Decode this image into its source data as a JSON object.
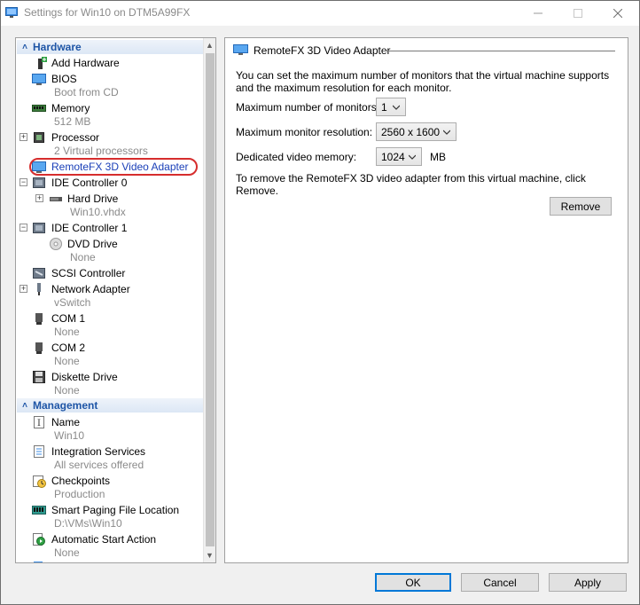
{
  "window": {
    "title": "Settings for Win10 on DTM5A99FX"
  },
  "tree": {
    "hardware_header": "Hardware",
    "management_header": "Management",
    "items": [
      {
        "label": "Add Hardware",
        "sub": ""
      },
      {
        "label": "BIOS",
        "sub": "Boot from CD"
      },
      {
        "label": "Memory",
        "sub": "512 MB"
      },
      {
        "label": "Processor",
        "sub": "2 Virtual processors"
      },
      {
        "label": "RemoteFX 3D Video Adapter",
        "sub": ""
      },
      {
        "label": "IDE Controller 0",
        "sub": ""
      },
      {
        "label": "Hard Drive",
        "sub": "Win10.vhdx"
      },
      {
        "label": "IDE Controller 1",
        "sub": ""
      },
      {
        "label": "DVD Drive",
        "sub": "None"
      },
      {
        "label": "SCSI Controller",
        "sub": ""
      },
      {
        "label": "Network Adapter",
        "sub": "vSwitch"
      },
      {
        "label": "COM 1",
        "sub": "None"
      },
      {
        "label": "COM 2",
        "sub": "None"
      },
      {
        "label": "Diskette Drive",
        "sub": "None"
      }
    ],
    "mgmt_items": [
      {
        "label": "Name",
        "sub": "Win10"
      },
      {
        "label": "Integration Services",
        "sub": "All services offered"
      },
      {
        "label": "Checkpoints",
        "sub": "Production"
      },
      {
        "label": "Smart Paging File Location",
        "sub": "D:\\VMs\\Win10"
      },
      {
        "label": "Automatic Start Action",
        "sub": "None"
      }
    ]
  },
  "panel": {
    "title": "RemoteFX 3D Video Adapter",
    "description": "You can set the maximum number of monitors that the virtual machine supports and the maximum resolution for each monitor.",
    "monitors_label": "Maximum number of monitors:",
    "monitors_value": "1",
    "resolution_label": "Maximum monitor resolution:",
    "resolution_value": "2560 x 1600",
    "vram_label": "Dedicated video memory:",
    "vram_value": "1024",
    "vram_unit": "MB",
    "remove_text": "To remove the RemoteFX 3D video adapter from this virtual machine, click Remove.",
    "remove_button": "Remove"
  },
  "footer": {
    "ok": "OK",
    "cancel": "Cancel",
    "apply": "Apply"
  },
  "colors": {
    "accent": "#0078d7",
    "section_text": "#1e55a6",
    "highlight_oval": "#d62d2d",
    "selected_text": "#1a3fb8"
  }
}
